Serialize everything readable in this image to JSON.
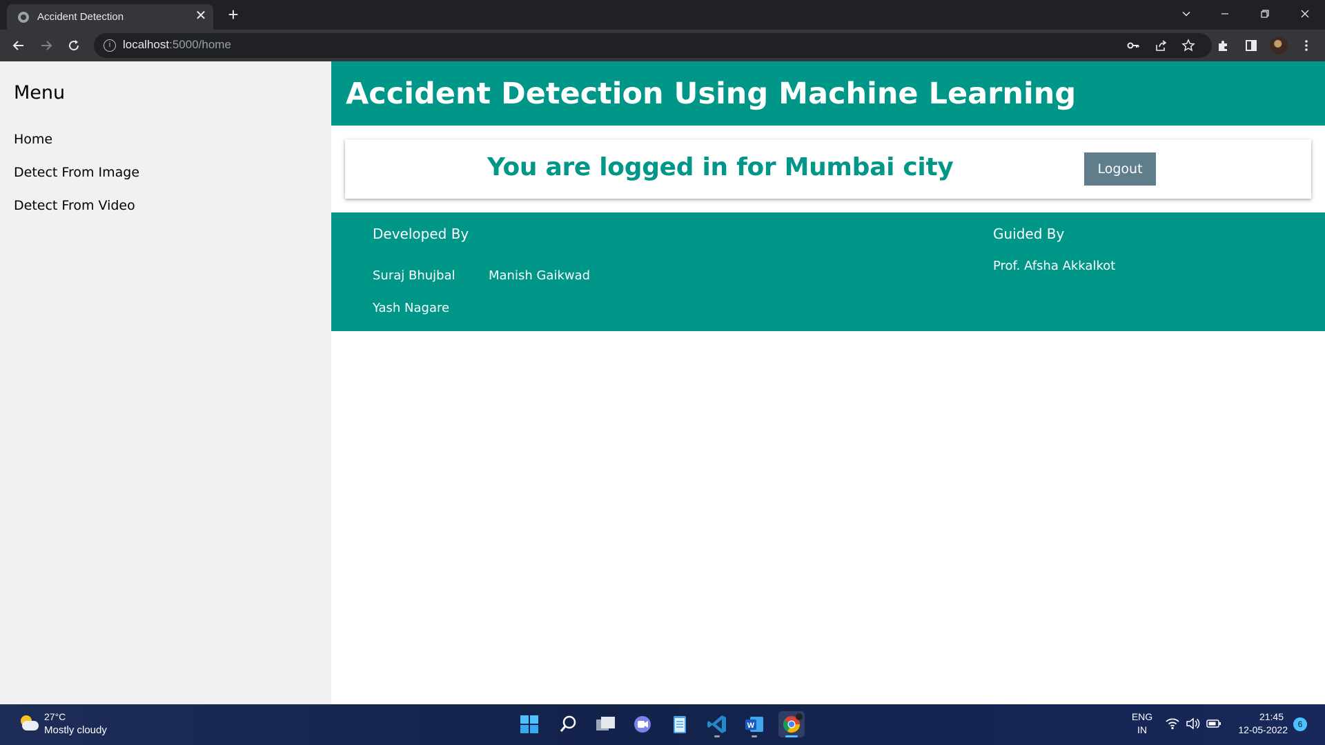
{
  "browser": {
    "tab_title": "Accident Detection",
    "tab_close": "✕",
    "new_tab": "+",
    "url_host": "localhost",
    "url_path": ":5000/home",
    "omni_info": "i"
  },
  "sidebar": {
    "title": "Menu",
    "items": [
      {
        "label": "Home"
      },
      {
        "label": "Detect From Image"
      },
      {
        "label": "Detect From Video"
      }
    ]
  },
  "header": {
    "title": "Accident Detection Using Machine Learning"
  },
  "login": {
    "message": "You are logged in for Mumbai city",
    "logout_label": "Logout"
  },
  "credits": {
    "developed_heading": "Developed By",
    "developers": [
      "Suraj Bhujbal",
      "Manish Gaikwad",
      "Yash Nagare"
    ],
    "guided_heading": "Guided By",
    "guide": "Prof. Afsha Akkalkot"
  },
  "taskbar": {
    "temperature": "27°C",
    "condition": "Mostly cloudy",
    "language": "ENG",
    "region": "IN",
    "time": "21:45",
    "date": "12-05-2022",
    "notifications": "6"
  },
  "colors": {
    "accent": "#009688",
    "logout_button": "#607d8b",
    "sidebar_bg": "#f1f1f1"
  }
}
